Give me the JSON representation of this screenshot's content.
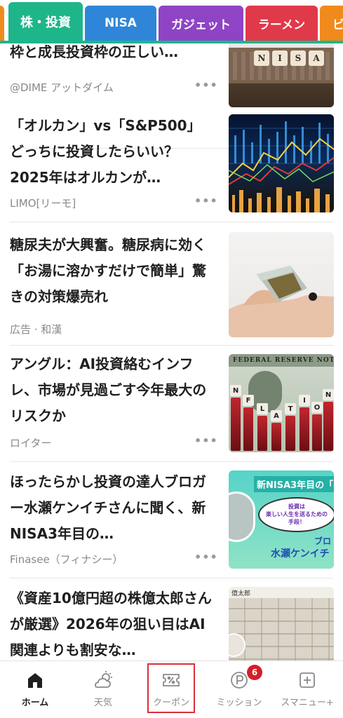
{
  "tabs": [
    {
      "label": "株・投資",
      "color": "#1fb58b",
      "active": true
    },
    {
      "label": "NISA",
      "color": "#2f86d8"
    },
    {
      "label": "ガジェット",
      "color": "#8e44c4"
    },
    {
      "label": "ラーメン",
      "color": "#e0394a"
    },
    {
      "label": "ビ",
      "color": "#f08a1c"
    }
  ],
  "articles": [
    {
      "headline": "枠と成長投資枠の正しい…",
      "source": "@DIME アットダイム",
      "more": "•••",
      "thumb": "nisa-blocks-image"
    },
    {
      "headline": "「オルカン」vs「S&P500」どっちに投資したらいい？2025年はオルカンが…",
      "source": "LIMO[リーモ]",
      "more": "•••",
      "thumb": "stock-chart-image"
    },
    {
      "headline": "糖尿夫が大興奮。糖尿病に効く「お湯に溶かすだけで簡単」驚きの対策爆売れ",
      "source": "広告 · 和漢",
      "more": "",
      "thumb": "tea-bag-hand-image"
    },
    {
      "headline": "アングル：AI投資絡むインフレ、市場が見過ごす今年最大のリスクか",
      "source": "ロイター",
      "more": "•••",
      "thumb": "inflation-dollar-image"
    },
    {
      "headline": "ほったらかし投資の達人ブロガー水瀬ケンイチさんに聞く、新NISA3年目の…",
      "source": "Finasee（フィナシー）",
      "more": "•••",
      "thumb": "nisa-banner-image"
    },
    {
      "headline": "《資産10億円超の株億太郎さんが厳選》2026年の狙い目はAI関連よりも割安な…",
      "source": "",
      "more": "",
      "thumb": "banknotes-image"
    }
  ],
  "thumb_text": {
    "nisa_blocks": "N I S A",
    "inflation_letters": [
      "N",
      "F",
      "L",
      "A",
      "T",
      "I",
      "O",
      "N"
    ],
    "inflation_dollar_top": "FEDERAL RESERVE NOTE",
    "banner_title": "新NISA3年目の「",
    "banner_bubble": "投資は\n楽しい人生を送るための\n手段！",
    "banner_name": "水瀬ケンイチ",
    "banner_side": "ブロ",
    "banknote_caption": "億太郎"
  },
  "bottom_nav": [
    {
      "label": "ホーム",
      "icon": "home-icon",
      "active": true
    },
    {
      "label": "天気",
      "icon": "weather-icon"
    },
    {
      "label": "クーポン",
      "icon": "coupon-icon",
      "highlighted": true
    },
    {
      "label": "ミッション",
      "icon": "mission-icon",
      "badge": "6"
    },
    {
      "label": "スマニュー+",
      "icon": "plus-icon"
    }
  ],
  "colors": {
    "accent": "#1fb58b",
    "badge": "#d41f2a",
    "highlight_box": "#d9303a"
  }
}
